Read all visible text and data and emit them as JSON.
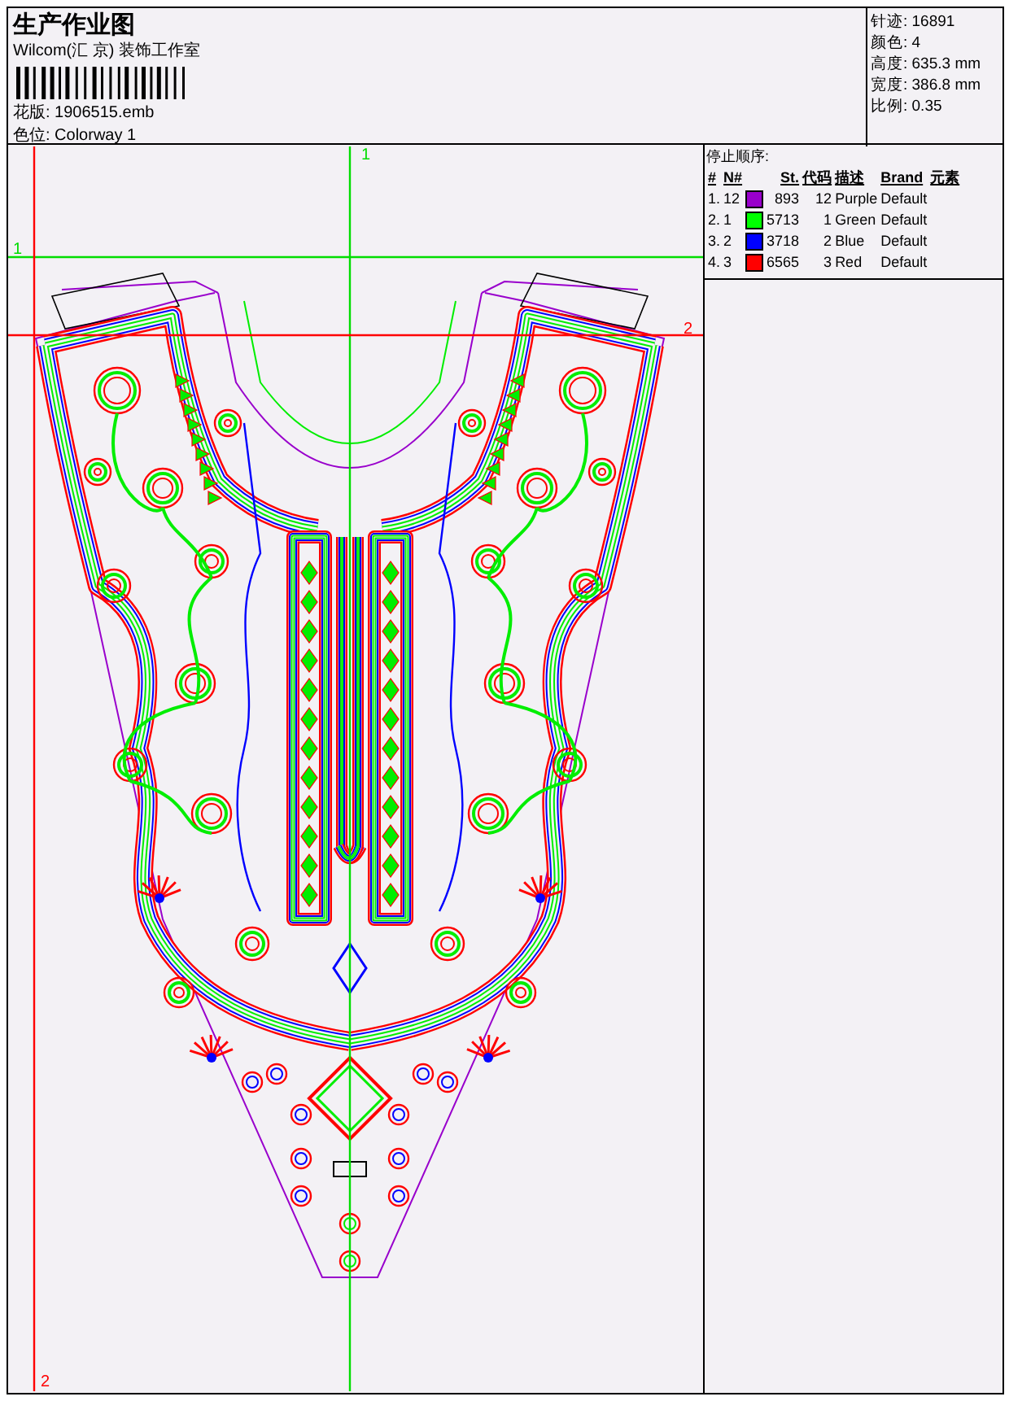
{
  "header": {
    "title": "生产作业图",
    "company": "Wilcom(汇 京) 装饰工作室",
    "fields": [
      {
        "label": "花版:",
        "value": "1906515.emb"
      },
      {
        "label": "色位:",
        "value": "Colorway 1"
      }
    ]
  },
  "stats": [
    {
      "label": "针迹:",
      "value": "16891"
    },
    {
      "label": "颜色:",
      "value": "4"
    },
    {
      "label": "高度:",
      "value": "635.3 mm"
    },
    {
      "label": "宽度:",
      "value": "386.8 mm"
    },
    {
      "label": "比例:",
      "value": "0.35"
    }
  ],
  "stop_sequence": {
    "title": "停止顺序:",
    "columns": [
      "#",
      "N#",
      "St.",
      "代码",
      "描述",
      "Brand",
      "元素"
    ],
    "rows": [
      {
        "index": "1.",
        "needle": "12",
        "color": "#9900cc",
        "stitches": "893",
        "code": "12",
        "description": "Purple",
        "brand": "Default"
      },
      {
        "index": "2.",
        "needle": "1",
        "color": "#00ff00",
        "stitches": "5713",
        "code": "1",
        "description": "Green",
        "brand": "Default"
      },
      {
        "index": "3.",
        "needle": "2",
        "color": "#0000ff",
        "stitches": "3718",
        "code": "2",
        "description": "Blue",
        "brand": "Default"
      },
      {
        "index": "4.",
        "needle": "3",
        "color": "#ff0000",
        "stitches": "6565",
        "code": "3",
        "description": "Red",
        "brand": "Default"
      }
    ]
  },
  "canvas": {
    "guides": [
      {
        "kind": "vertical",
        "label": "1",
        "color": "#00dd00"
      },
      {
        "kind": "horizontal",
        "label": "1",
        "color": "#00dd00"
      },
      {
        "kind": "vertical",
        "label": "2",
        "color": "#ff0000"
      },
      {
        "kind": "horizontal",
        "label": "2",
        "color": "#ff0000"
      }
    ]
  }
}
